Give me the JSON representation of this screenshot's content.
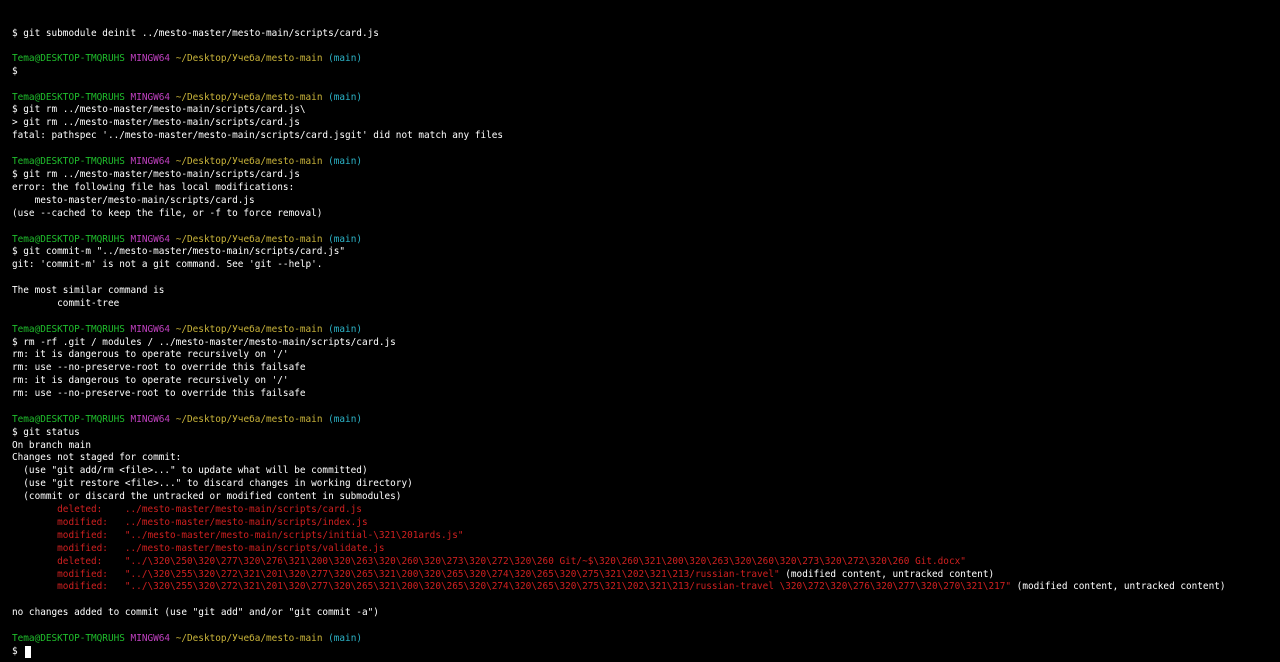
{
  "prompt": {
    "user_host": "Tema@DESKTOP-TMQRUHS",
    "shell": "MINGW64",
    "path": "~/Desktop/Учеба/mesto-main",
    "branch": "(main)",
    "symbol": "$"
  },
  "lines": {
    "l01": "$ git submodule deinit ../mesto-master/mesto-main/scripts/card.js",
    "l03": "$",
    "l05": "$ git rm ../mesto-master/mesto-main/scripts/card.js\\",
    "l06": "> git rm ../mesto-master/mesto-main/scripts/card.js",
    "l07": "fatal: pathspec '../mesto-master/mesto-main/scripts/card.jsgit' did not match any files",
    "l09": "$ git rm ../mesto-master/mesto-main/scripts/card.js",
    "l10": "error: the following file has local modifications:",
    "l11": "    mesto-master/mesto-main/scripts/card.js",
    "l12": "(use --cached to keep the file, or -f to force removal)",
    "l14": "$ git commit-m \"../mesto-master/mesto-main/scripts/card.js\"",
    "l15": "git: 'commit-m' is not a git command. See 'git --help'.",
    "l17": "The most similar command is",
    "l18": "        commit-tree",
    "l20": "$ rm -rf .git / modules / ../mesto-master/mesto-main/scripts/card.js",
    "l21": "rm: it is dangerous to operate recursively on '/'",
    "l22": "rm: use --no-preserve-root to override this failsafe",
    "l23": "rm: it is dangerous to operate recursively on '/'",
    "l24": "rm: use --no-preserve-root to override this failsafe",
    "l26": "$ git status",
    "l27": "On branch main",
    "l28": "Changes not staged for commit:",
    "l29": "  (use \"git add/rm <file>...\" to update what will be committed)",
    "l30": "  (use \"git restore <file>...\" to discard changes in working directory)",
    "l31": "  (commit or discard the untracked or modified content in submodules)",
    "l32": "        deleted:    ../mesto-master/mesto-main/scripts/card.js",
    "l33": "        modified:   ../mesto-master/mesto-main/scripts/index.js",
    "l34": "        modified:   \"../mesto-master/mesto-main/scripts/initial-\\321\\201ards.js\"",
    "l35": "        modified:   ../mesto-master/mesto-main/scripts/validate.js",
    "l36": "        deleted:    \"../\\320\\250\\320\\277\\320\\276\\321\\200\\320\\263\\320\\260\\320\\273\\320\\272\\320\\260 Git/~$\\320\\260\\321\\200\\320\\263\\320\\260\\320\\273\\320\\272\\320\\260 Git.docx\"",
    "l37a": "        modified:   \"../\\320\\255\\320\\272\\321\\201\\320\\277\\320\\265\\321\\200\\320\\265\\320\\274\\320\\265\\320\\275\\321\\202\\321\\213/russian-travel\"",
    "l37b": " (modified content, untracked content)",
    "l38a": "        modified:   \"../\\320\\255\\320\\272\\321\\201\\320\\277\\320\\265\\321\\200\\320\\265\\320\\274\\320\\265\\320\\275\\321\\202\\321\\213/russian-travel \\320\\272\\320\\276\\320\\277\\320\\270\\321\\217\"",
    "l38b": " (modified content, untracked content)",
    "l40": "no changes added to commit (use \"git add\" and/or \"git commit -a\")",
    "l42": "$"
  }
}
